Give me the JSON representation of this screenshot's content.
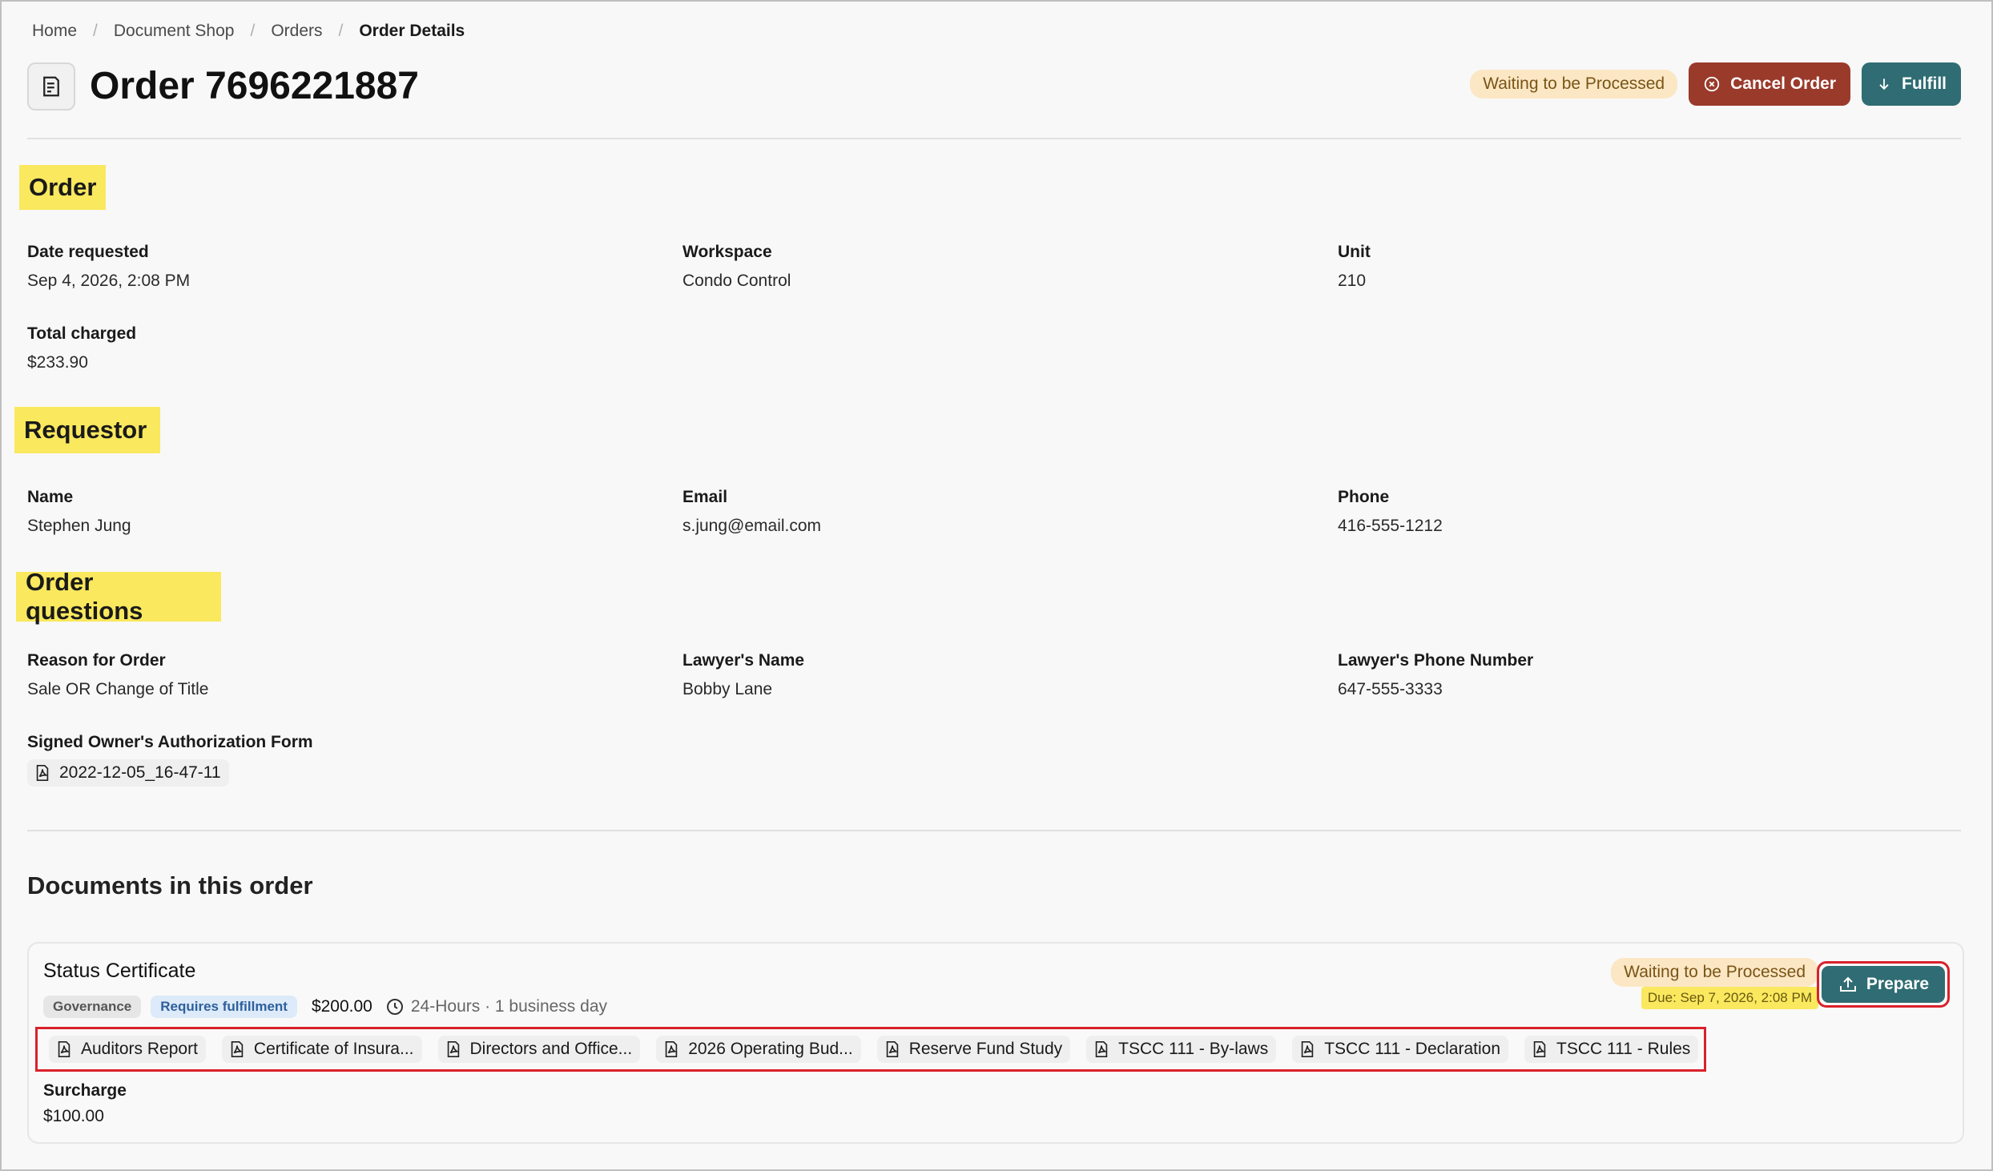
{
  "breadcrumb": {
    "items": [
      "Home",
      "Document Shop",
      "Orders"
    ],
    "current": "Order Details"
  },
  "header": {
    "title": "Order 7696221887",
    "status": "Waiting to be Processed",
    "cancel_label": "Cancel Order",
    "fulfill_label": "Fulfill",
    "page_icon": "receipt-icon"
  },
  "order": {
    "heading": "Order",
    "date_requested_label": "Date requested",
    "date_requested": "Sep 4, 2026, 2:08 PM",
    "workspace_label": "Workspace",
    "workspace": "Condo Control",
    "unit_label": "Unit",
    "unit": "210",
    "total_label": "Total charged",
    "total": "$233.90"
  },
  "requestor": {
    "heading": "Requestor",
    "name_label": "Name",
    "name": "Stephen Jung",
    "email_label": "Email",
    "email": "s.jung@email.com",
    "phone_label": "Phone",
    "phone": "416-555-1212"
  },
  "questions": {
    "heading": "Order questions",
    "reason_label": "Reason for Order",
    "reason": "Sale OR Change of Title",
    "lawyer_name_label": "Lawyer's Name",
    "lawyer_name": "Bobby Lane",
    "lawyer_phone_label": "Lawyer's Phone Number",
    "lawyer_phone": "647-555-3333",
    "auth_form_label": "Signed Owner's Authorization Form",
    "auth_form_file": "2022-12-05_16-47-11"
  },
  "documents": {
    "heading": "Documents in this order",
    "item": {
      "title": "Status Certificate",
      "tag_category": "Governance",
      "tag_fulfillment": "Requires fulfillment",
      "price": "$200.00",
      "turnaround": "24-Hours · 1 business day",
      "status": "Waiting to be Processed",
      "due": "Due: Sep 7, 2026, 2:08 PM",
      "prepare_label": "Prepare",
      "files": [
        "Auditors Report",
        "Certificate of Insura...",
        "Directors and Office...",
        "2026 Operating Bud...",
        "Reserve Fund Study",
        "TSCC 111 - By-laws",
        "TSCC 111 - Declaration",
        "TSCC 111 - Rules"
      ],
      "surcharge_label": "Surcharge",
      "surcharge": "$100.00"
    }
  },
  "colors": {
    "accent_teal": "#2f6c73",
    "cancel_red": "#9a3a2b",
    "highlight_yellow": "#fae85e",
    "waiting_bg": "#fbe7c4",
    "annotation_red": "#d9212b"
  }
}
